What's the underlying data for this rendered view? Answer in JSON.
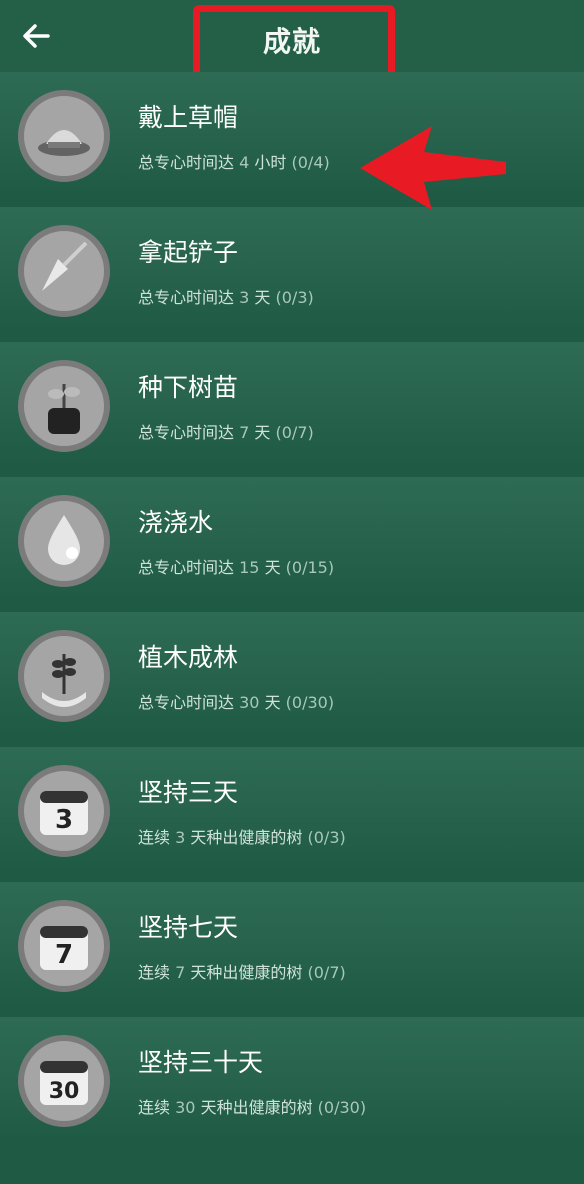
{
  "header": {
    "title": "成就"
  },
  "achievements": [
    {
      "name": "戴上草帽",
      "desc_prefix": "总专心时间达",
      "desc_num": "4",
      "desc_unit": "小时",
      "progress": "(0/4)",
      "icon": "hat-icon"
    },
    {
      "name": "拿起铲子",
      "desc_prefix": "总专心时间达",
      "desc_num": "3",
      "desc_unit": "天",
      "progress": "(0/3)",
      "icon": "shovel-icon"
    },
    {
      "name": "种下树苗",
      "desc_prefix": "总专心时间达",
      "desc_num": "7",
      "desc_unit": "天",
      "progress": "(0/7)",
      "icon": "sapling-icon"
    },
    {
      "name": "浇浇水",
      "desc_prefix": "总专心时间达",
      "desc_num": "15",
      "desc_unit": "天",
      "progress": "(0/15)",
      "icon": "water-drop-icon"
    },
    {
      "name": "植木成林",
      "desc_prefix": "总专心时间达",
      "desc_num": "30",
      "desc_unit": "天",
      "progress": "(0/30)",
      "icon": "hands-plant-icon"
    },
    {
      "name": "坚持三天",
      "desc_prefix": "连续",
      "desc_num": "3",
      "desc_unit": "天种出健康的树",
      "progress": "(0/3)",
      "icon": "calendar-icon",
      "calendar": "3"
    },
    {
      "name": "坚持七天",
      "desc_prefix": "连续",
      "desc_num": "7",
      "desc_unit": "天种出健康的树",
      "progress": "(0/7)",
      "icon": "calendar-icon",
      "calendar": "7"
    },
    {
      "name": "坚持三十天",
      "desc_prefix": "连续",
      "desc_num": "30",
      "desc_unit": "天种出健康的树",
      "progress": "(0/30)",
      "icon": "calendar-icon",
      "calendar": "30"
    }
  ],
  "colors": {
    "background": "#1f5a45",
    "highlight": "#e81b24"
  }
}
